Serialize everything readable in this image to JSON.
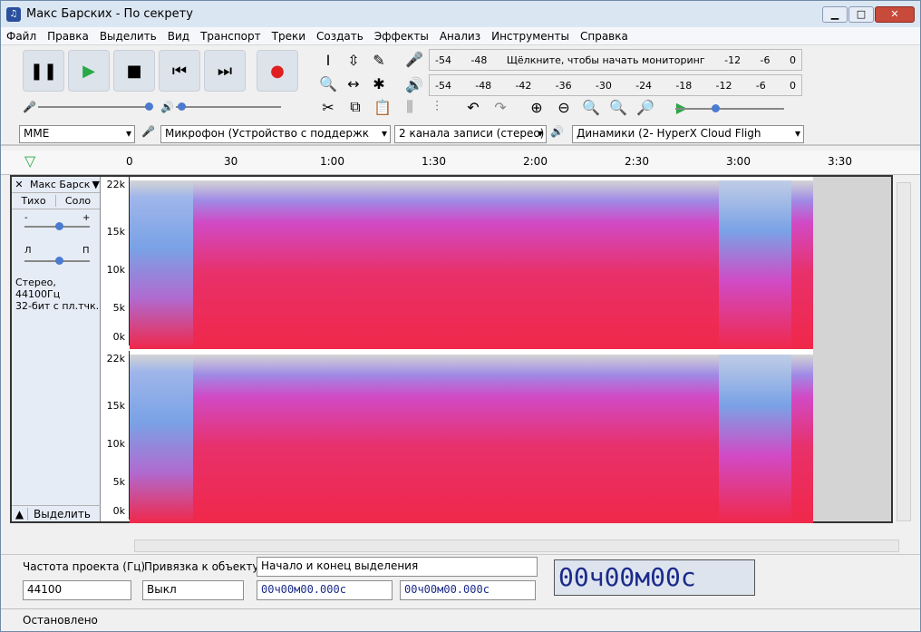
{
  "window": {
    "title": "Макс Барских - По секрету",
    "status": "Остановлено"
  },
  "menu": [
    "Файл",
    "Правка",
    "Выделить",
    "Вид",
    "Транспорт",
    "Треки",
    "Создать",
    "Эффекты",
    "Анализ",
    "Инструменты",
    "Справка"
  ],
  "meter": {
    "rec_prompt": "Щёлкните, чтобы начать мониторинг",
    "ticks_rec": [
      "-54",
      "-48",
      "-12",
      "-6",
      "0"
    ],
    "ticks_play": [
      "-54",
      "-48",
      "-42",
      "-36",
      "-30",
      "-24",
      "-18",
      "-12",
      "-6",
      "0"
    ],
    "channel_labels": [
      "Л",
      "П"
    ]
  },
  "devices": {
    "host": "MME",
    "mic": "Микрофон (Устройство с поддержк",
    "channels": "2 канала записи (стерео)",
    "output": "Динамики (2- HyperX Cloud Fligh"
  },
  "timeline": {
    "labels": [
      "0",
      "30",
      "1:00",
      "1:30",
      "2:00",
      "2:30",
      "3:00",
      "3:30"
    ]
  },
  "track": {
    "name": "Макс Барск",
    "mute": "Тихо",
    "solo": "Соло",
    "gain_minus": "-",
    "gain_plus": "+",
    "pan_left": "Л",
    "pan_right": "П",
    "info1": "Стерео, 44100Гц",
    "info2": "32-бит с пл.тчк.",
    "select": "Выделить"
  },
  "axis": {
    "labels": [
      "22k",
      "15k",
      "10k",
      "5k",
      "0k"
    ]
  },
  "colors": {
    "spec_red": "#f0284a",
    "spec_magenta": "#d14ac6",
    "spec_blue": "#7aa2e6",
    "bg": "#d4d4d4"
  },
  "selection": {
    "rate_label": "Частота проекта (Гц)",
    "rate_value": "44100",
    "snap_label": "Привязка к объекту",
    "snap_value": "Выкл",
    "sel_mode": "Начало и конец выделения",
    "t1": "00ч00м00.000с",
    "t2": "00ч00м00.000с",
    "clock": "00ч00м00с"
  }
}
